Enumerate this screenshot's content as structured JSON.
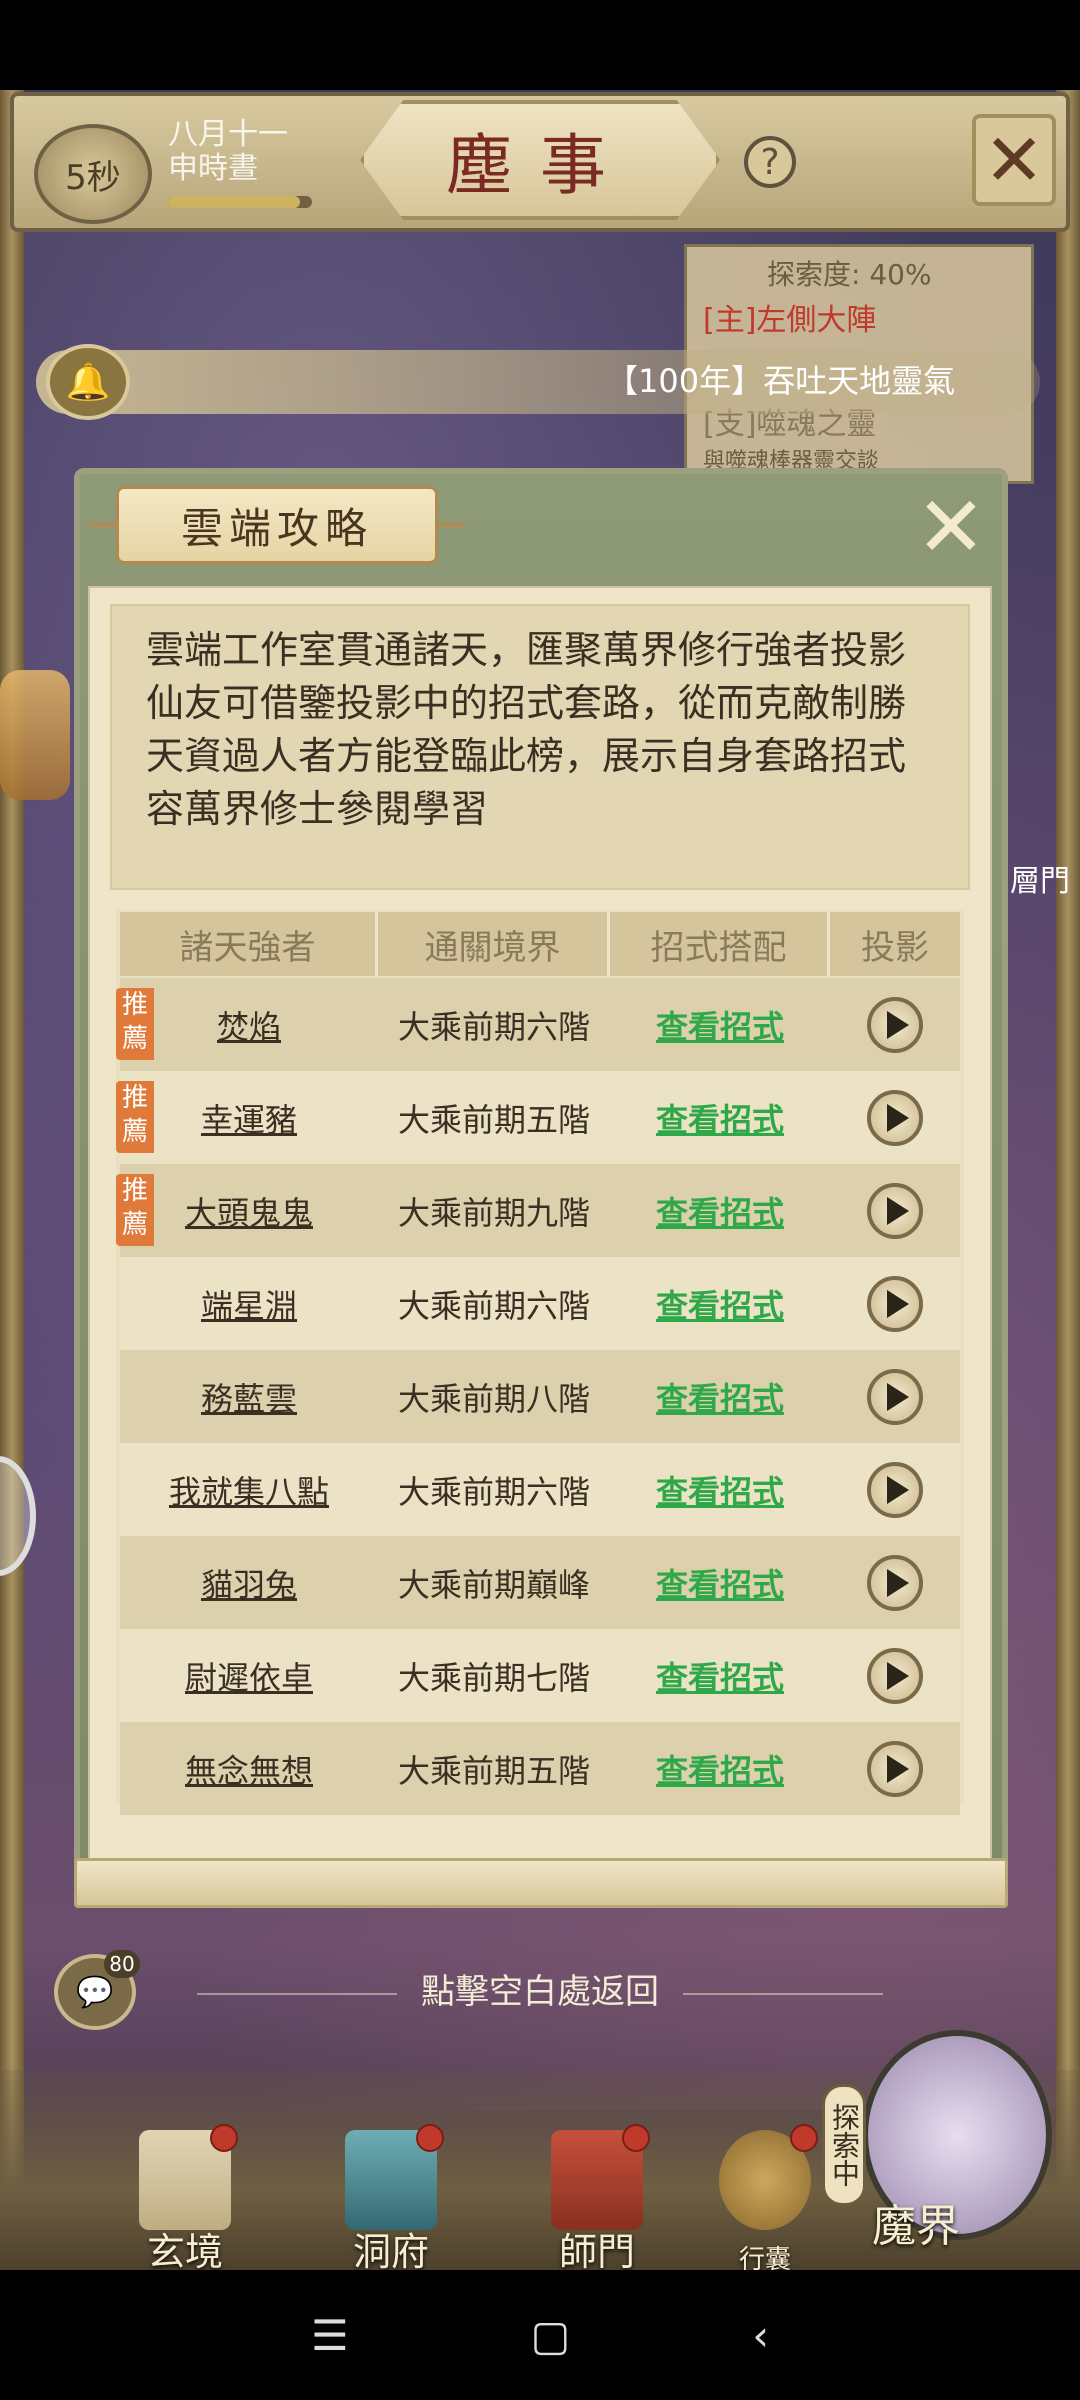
{
  "header": {
    "timer": "5秒",
    "date_line1": "八月十一",
    "date_line2": "申時晝",
    "date_progress": 0.92,
    "title": "塵事",
    "help_icon": "question-icon",
    "exit_icon": "crossed-swords-icon"
  },
  "explore_panel": {
    "label": "探索度: 40%",
    "quest1": "[主]左側大陣",
    "quest2": "[支]噬魂之靈",
    "quest3": "與噬魂棒器靈交談"
  },
  "notice": {
    "text": "【100年】吞吐天地靈氣"
  },
  "side_text": "層門",
  "dialog": {
    "title": "雲端攻略",
    "close_icon": "close-x-icon",
    "description": "雲端工作室貫通諸天，匯聚萬界修行強者投影\n仙友可借鑒投影中的招式套路，從而克敵制勝\n天資過人者方能登臨此榜，展示自身套路招式\n容萬界修士參閱學習",
    "table": {
      "headers": [
        "諸天強者",
        "通關境界",
        "招式搭配",
        "投影"
      ],
      "recommend_label": "推薦",
      "rows": [
        {
          "name": "焚焰",
          "realm": "大乘前期六階",
          "action": "查看招式",
          "recommended": true
        },
        {
          "name": "幸運豬",
          "realm": "大乘前期五階",
          "action": "查看招式",
          "recommended": true
        },
        {
          "name": "大頭鬼鬼",
          "realm": "大乘前期九階",
          "action": "查看招式",
          "recommended": true
        },
        {
          "name": "端星淵",
          "realm": "大乘前期六階",
          "action": "查看招式",
          "recommended": false
        },
        {
          "name": "務藍雲",
          "realm": "大乘前期八階",
          "action": "查看招式",
          "recommended": false
        },
        {
          "name": "我就集八點",
          "realm": "大乘前期六階",
          "action": "查看招式",
          "recommended": false
        },
        {
          "name": "貓羽兔",
          "realm": "大乘前期巔峰",
          "action": "查看招式",
          "recommended": false
        },
        {
          "name": "尉遲依卓",
          "realm": "大乘前期七階",
          "action": "查看招式",
          "recommended": false
        },
        {
          "name": "無念無想",
          "realm": "大乘前期五階",
          "action": "查看招式",
          "recommended": false
        }
      ]
    }
  },
  "hint": "點擊空白處返回",
  "chat_badge": "80",
  "bottom_nav": [
    {
      "label": "玄境",
      "icon": "scroll-icon"
    },
    {
      "label": "洞府",
      "icon": "pavilion-icon"
    },
    {
      "label": "師門",
      "icon": "banner-icon"
    },
    {
      "label": "行囊",
      "icon": "bag-icon"
    }
  ],
  "demon_realm": {
    "label": "魔界",
    "tag": "探索中"
  },
  "system_nav": {
    "menu": "☰",
    "home": "▢",
    "back": "‹"
  }
}
